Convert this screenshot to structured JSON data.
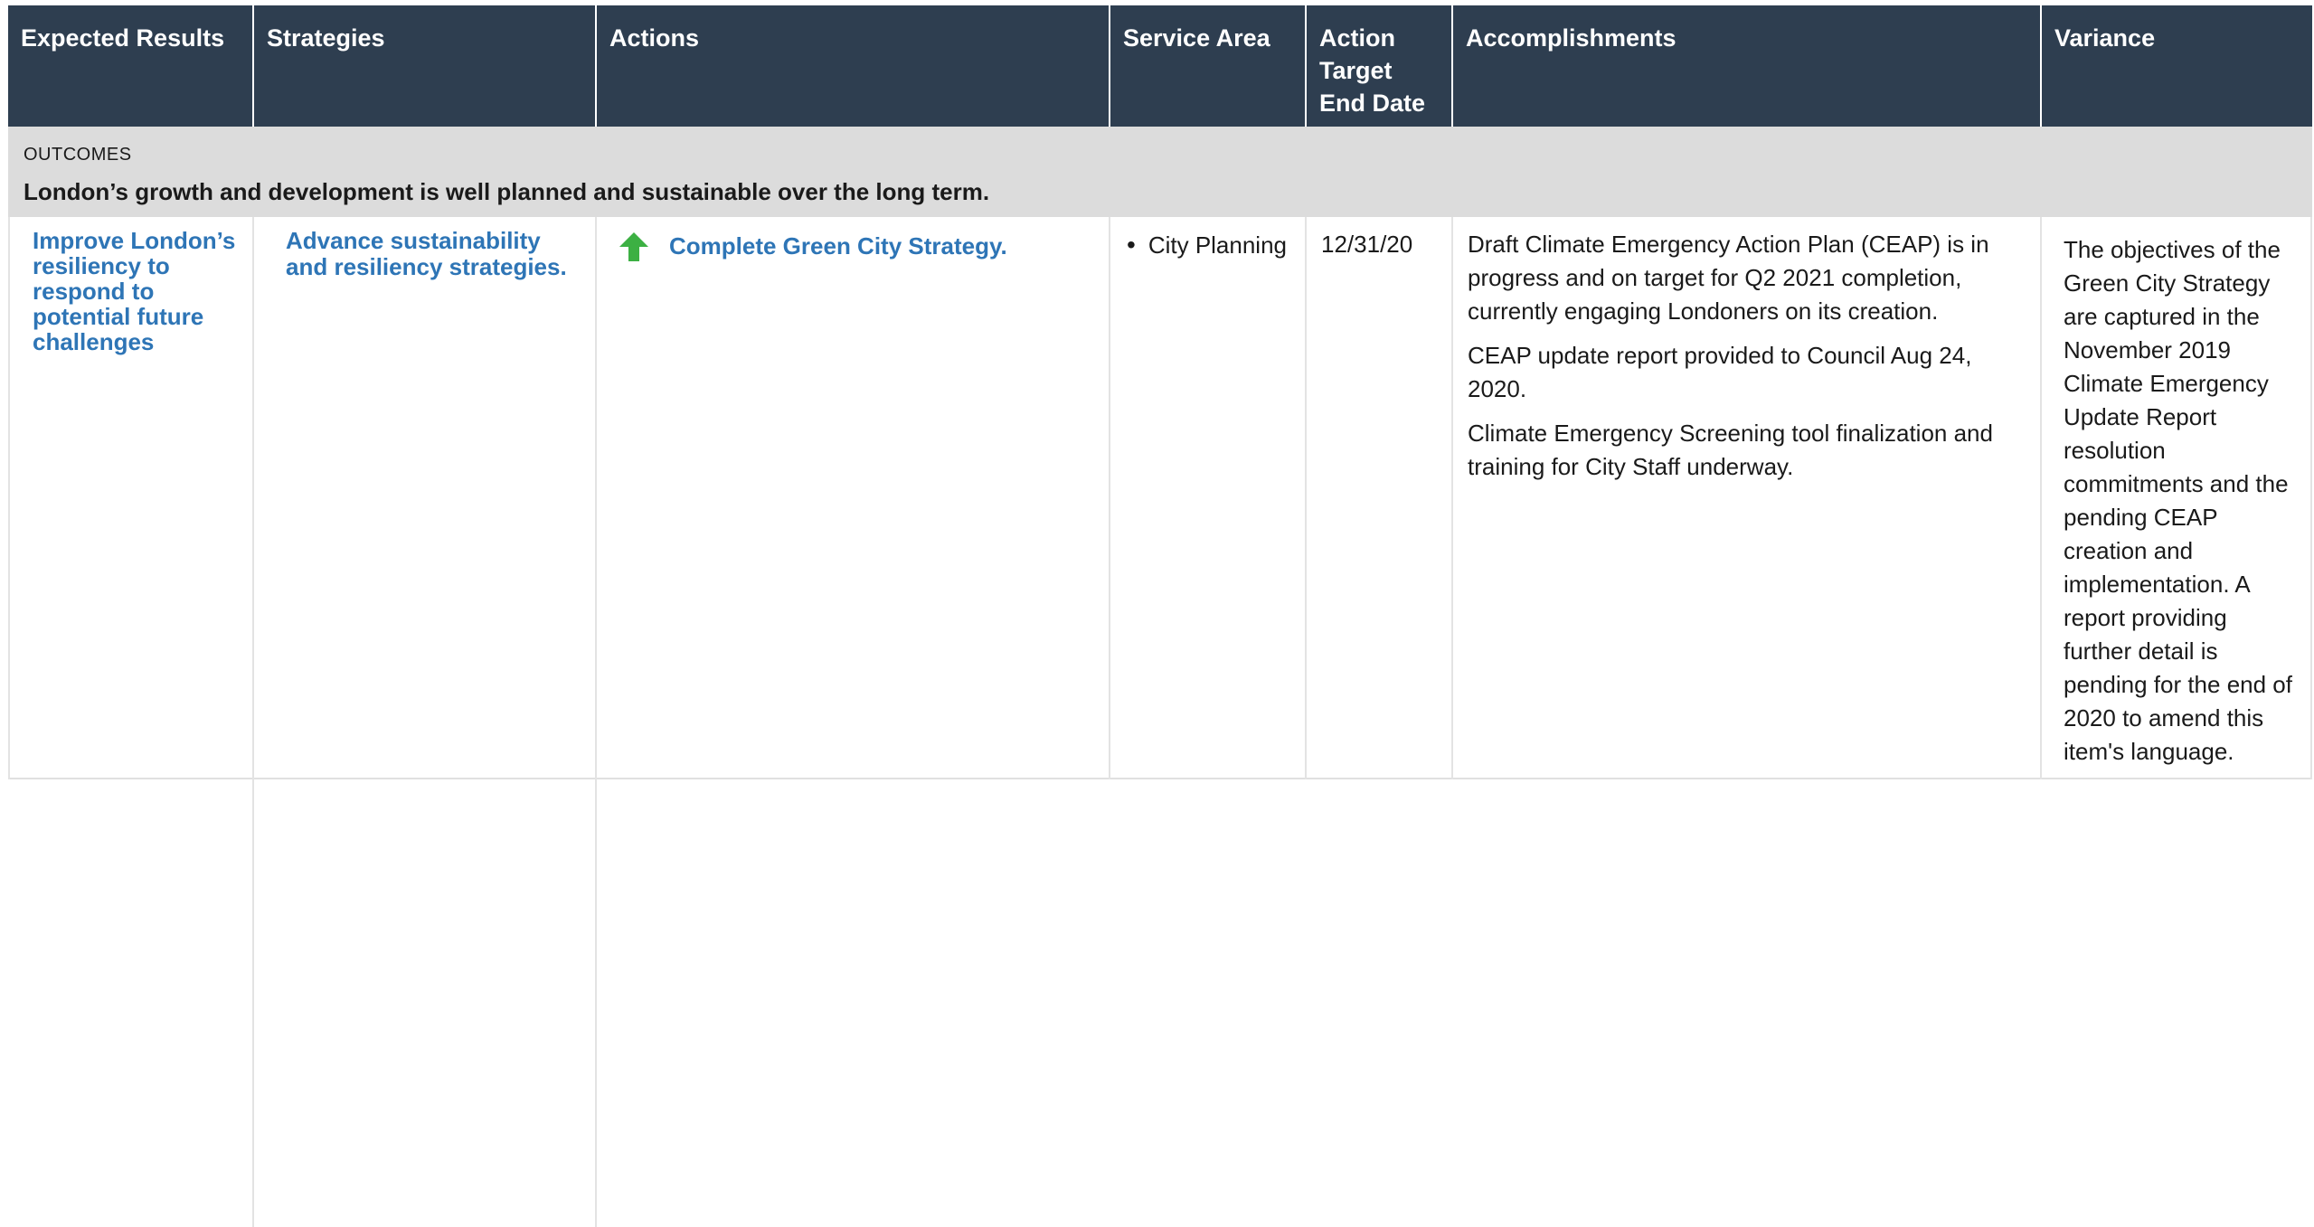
{
  "headers": {
    "expected_results": "Expected Results",
    "strategies": "Strategies",
    "actions": "Actions",
    "service_area": "Service Area",
    "action_target_end_date": "Action Target End Date",
    "accomplishments": "Accomplishments",
    "variance": "Variance"
  },
  "outcomes": {
    "label": "OUTCOMES",
    "text": "London’s growth and development is well planned and sustainable over the long term."
  },
  "row": {
    "expected_result": "Improve London’s resiliency to respond to potential future challenges",
    "strategy": "Advance sustainability and resiliency strategies.",
    "action": "Complete Green City Strategy.",
    "action_status_icon": "green-up-arrow-icon",
    "service_area": "City Planning",
    "target_end_date": "12/31/20",
    "accomplishments": [
      "Draft Climate Emergency Action Plan (CEAP) is in progress and on target for Q2 2021 completion, currently engaging Londoners on its creation.",
      "CEAP update report provided to Council Aug 24, 2020.",
      "Climate Emergency Screening tool finalization and training for City Staff underway."
    ],
    "variance": "The objectives of the Green City Strategy are captured in the November 2019 Climate Emergency Update Report resolution commitments and the pending CEAP creation and implementation.  A report providing further detail is pending for the end of 2020 to amend this item's language."
  },
  "colors": {
    "header_bg": "#2e3e50",
    "outcomes_bg": "#dcdcdc",
    "link_blue": "#2e75b6",
    "arrow_green": "#3cb043"
  }
}
